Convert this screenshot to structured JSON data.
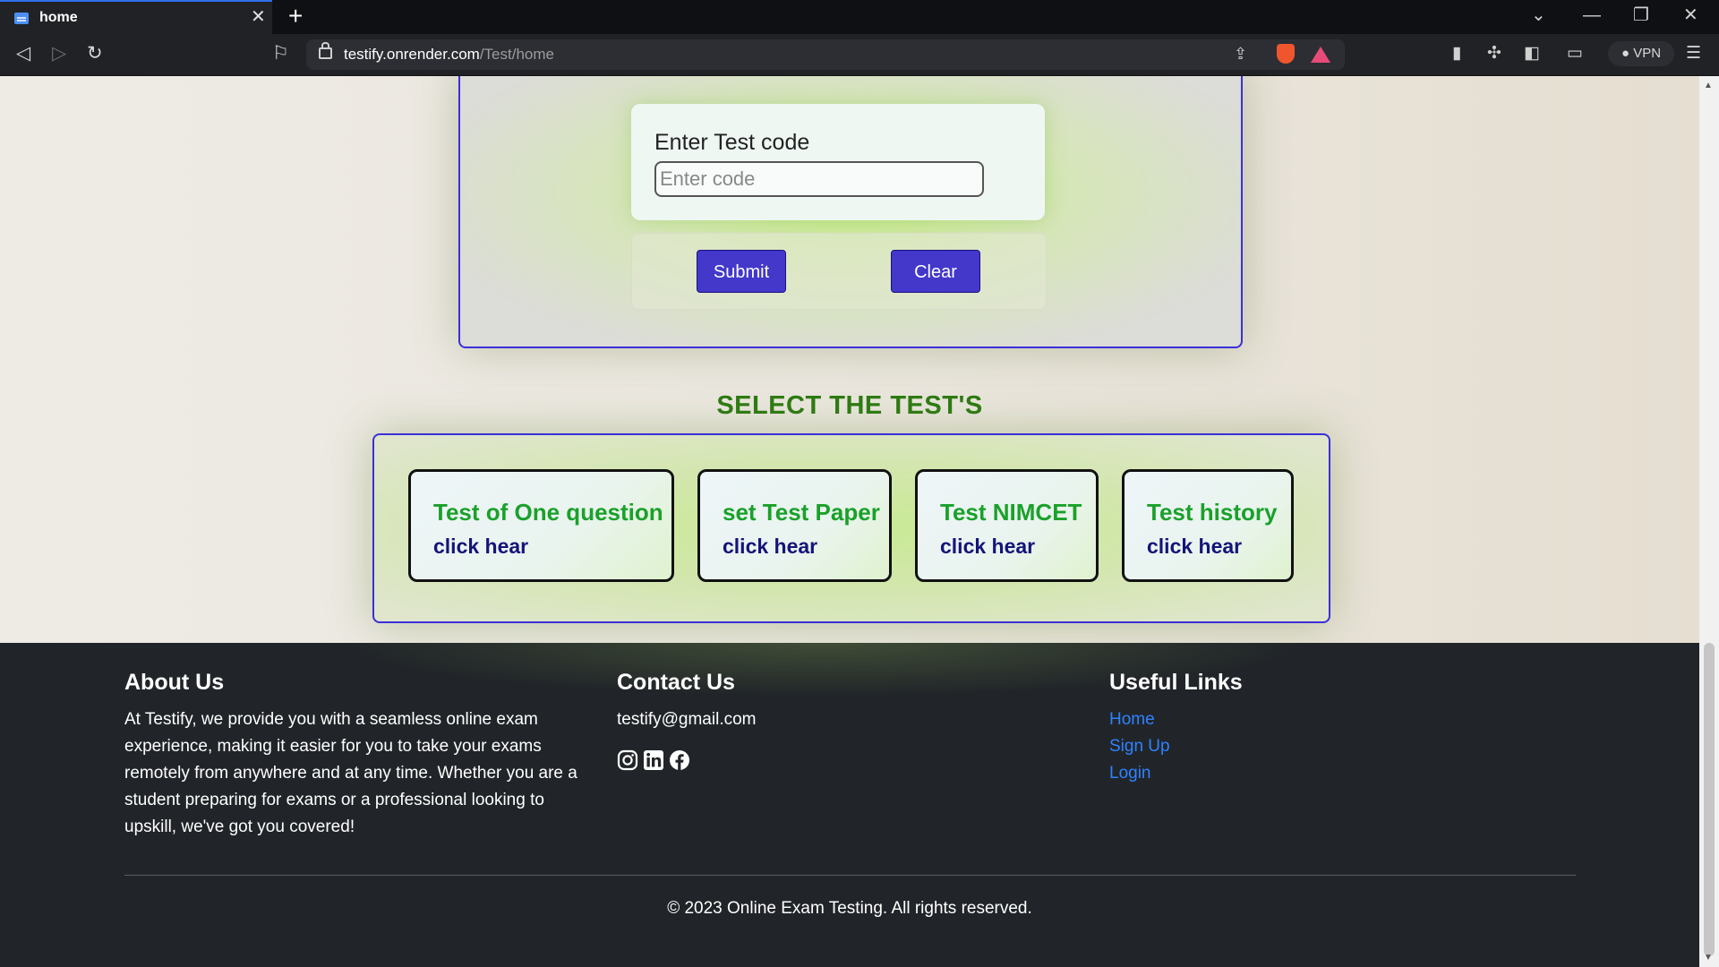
{
  "browser": {
    "tab_title": "home",
    "url_host": "testify.onrender.com",
    "url_path": "/Test/home",
    "vpn_label": "VPN"
  },
  "code_form": {
    "label": "Enter Test code",
    "placeholder": "Enter code",
    "value": "",
    "submit_label": "Submit",
    "clear_label": "Clear"
  },
  "tests": {
    "title": "SELECT THE TEST'S",
    "cards": [
      {
        "name": "Test of One question",
        "link": "click hear"
      },
      {
        "name": "set Test Paper",
        "link": "click hear"
      },
      {
        "name": "Test NIMCET",
        "link": "click hear"
      },
      {
        "name": "Test history",
        "link": "click hear"
      }
    ]
  },
  "footer": {
    "about_title": "About Us",
    "about_text": "At Testify, we provide you with a seamless online exam experience, making it easier for you to take your exams remotely from anywhere and at any time. Whether you are a student preparing for exams or a professional looking to upskill, we've got you covered!",
    "contact_title": "Contact Us",
    "contact_email": "testify@gmail.com",
    "social_icons": [
      "instagram-icon",
      "linkedin-icon",
      "facebook-icon"
    ],
    "links_title": "Useful Links",
    "links": [
      "Home",
      "Sign Up",
      "Login"
    ],
    "link_color": "#2e82ff",
    "copyright": "© 2023 Online Exam Testing. All rights reserved."
  },
  "colors": {
    "accent_button": "#4338ca",
    "panel_border": "#3b2fd8",
    "test_name": "#1aa12a",
    "test_link": "#14147a",
    "section_title": "#2d7a12",
    "footer_bg": "#212529"
  }
}
